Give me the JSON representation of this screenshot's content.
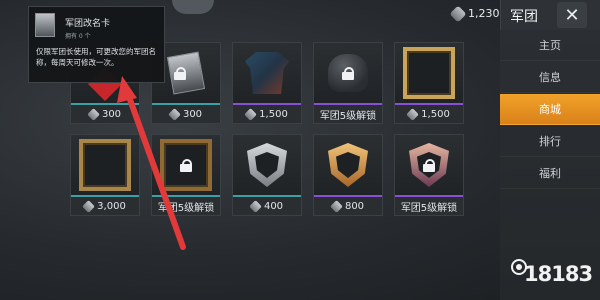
{
  "header": {
    "title": "军团",
    "close_glyph": "✕",
    "coin_balance": "1,230"
  },
  "sidebar": {
    "items": [
      {
        "label": "主页",
        "active": false
      },
      {
        "label": "信息",
        "active": false
      },
      {
        "label": "商城",
        "active": true
      },
      {
        "label": "排行",
        "active": false
      },
      {
        "label": "福利",
        "active": false
      }
    ]
  },
  "tooltip": {
    "title": "军团改名卡",
    "owned": "拥有 0 个",
    "description": "仅限军团长使用，可更改您的军团名称，每周天可修改一次。"
  },
  "shop_items": [
    {
      "name": "red-badge",
      "price": "300",
      "locked": false,
      "rarity_color": "#3aa0a5"
    },
    {
      "name": "rename-card",
      "price": "300",
      "locked": true,
      "rarity_color": "#3aa0a5"
    },
    {
      "name": "jacket",
      "price": "1,500",
      "locked": false,
      "rarity_color": "#8a4fd8"
    },
    {
      "name": "helmet",
      "price": "军团5级解锁",
      "locked": true,
      "rarity_color": "#8a4fd8"
    },
    {
      "name": "gold-frame",
      "price": "1,500",
      "locked": false,
      "rarity_color": "#8a4fd8"
    },
    {
      "name": "bronze-frame",
      "price": "3,000",
      "locked": false,
      "rarity_color": "#3aa0a5"
    },
    {
      "name": "ornate-frame",
      "price": "军团5级解锁",
      "locked": true,
      "rarity_color": "#3aa0a5"
    },
    {
      "name": "silver-shield",
      "price": "400",
      "locked": false,
      "rarity_color": "#3aa0a5"
    },
    {
      "name": "gold-shield",
      "price": "800",
      "locked": false,
      "rarity_color": "#8a4fd8"
    },
    {
      "name": "purple-shield",
      "price": "军团5级解锁",
      "locked": true,
      "rarity_color": "#8a4fd8"
    }
  ],
  "watermark": {
    "text": "18183"
  },
  "colors": {
    "accent": "#e89422",
    "arrow": "#e23a3a"
  }
}
